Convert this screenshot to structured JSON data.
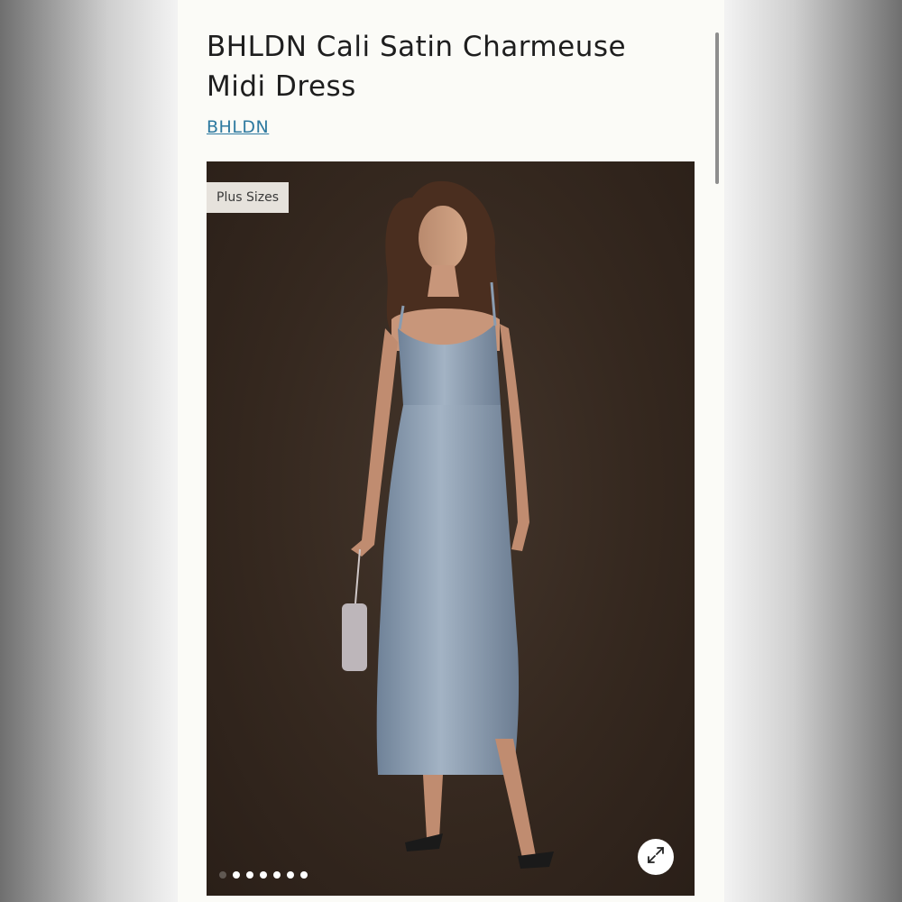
{
  "product": {
    "title_line1": "BHLDN Cali Satin Charmeuse",
    "title_line2": "Midi Dress",
    "brand": "BHLDN"
  },
  "gallery": {
    "badge": "Plus Sizes",
    "image_description": "model-in-dusty-blue-satin-slip-dress",
    "slide_count": 7,
    "active_slide": 2,
    "expand_icon": "expand-arrows-icon"
  },
  "colors": {
    "link": "#2e7aa0",
    "background": "#fbfbf7",
    "photo_backdrop": "#35281f",
    "dress": "#8a9cb0"
  }
}
